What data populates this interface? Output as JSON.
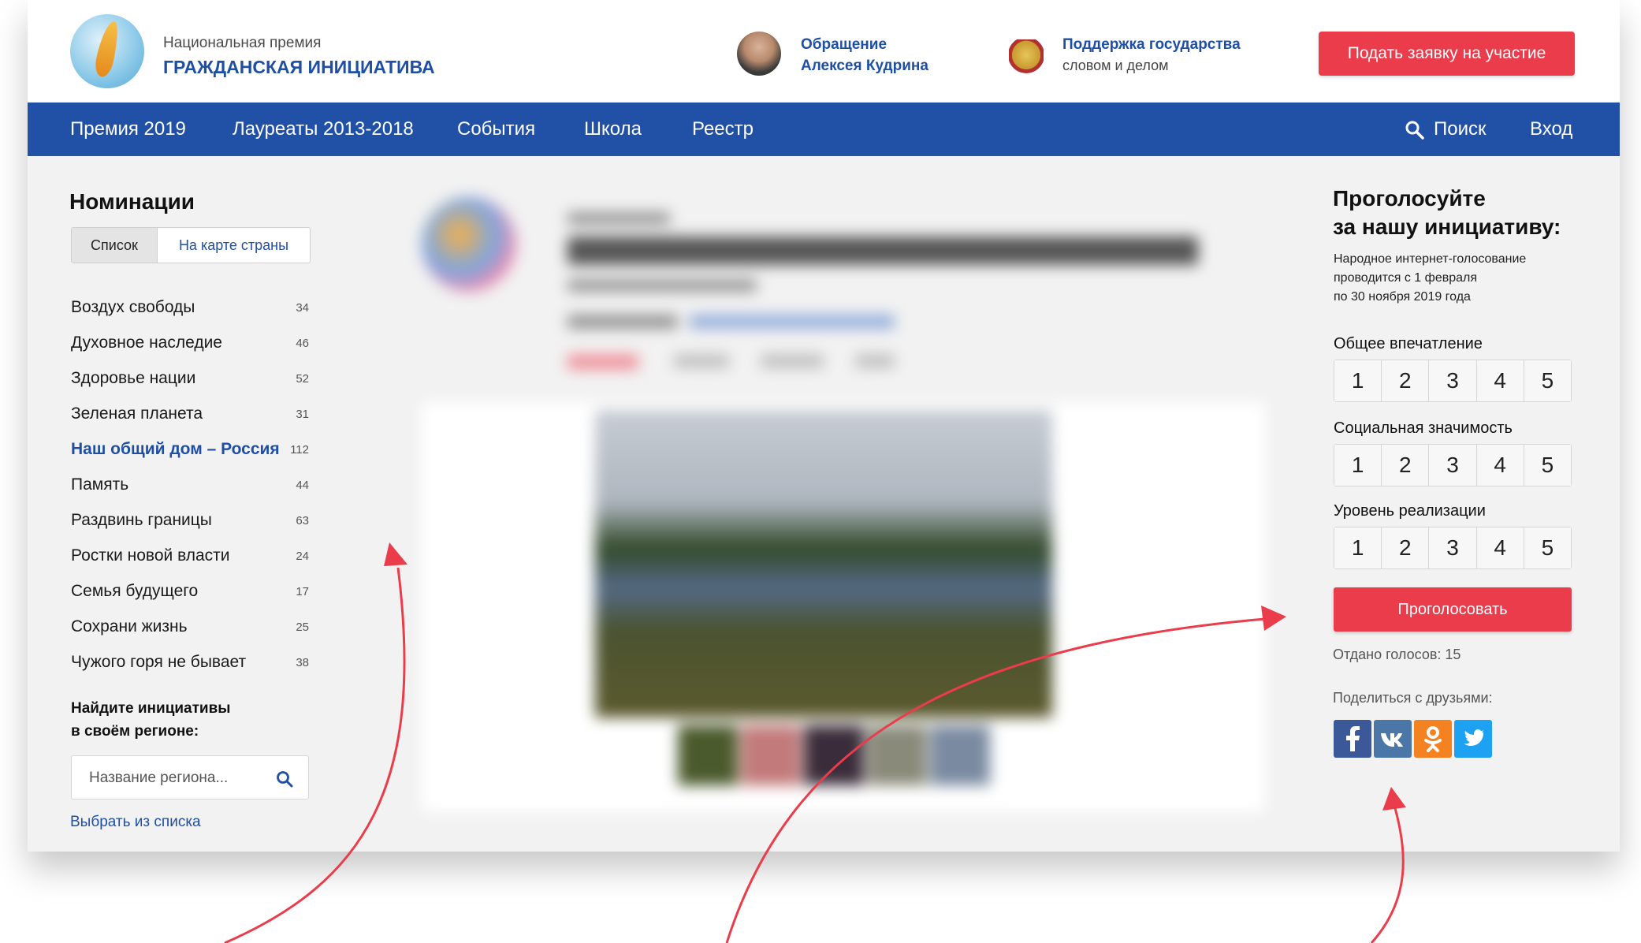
{
  "header": {
    "brand_subtitle": "Национальная премия",
    "brand_title": "ГРАЖДАНСКАЯ ИНИЦИАТИВА",
    "appeal_line1": "Обращение",
    "appeal_line2": "Алексея Кудрина",
    "support_line1": "Поддержка государства",
    "support_line2": "словом и делом",
    "apply_button": "Подать заявку на участие"
  },
  "nav": {
    "items": [
      "Премия 2019",
      "Лауреаты 2013-2018",
      "События",
      "Школа",
      "Реестр"
    ],
    "search": "Поиск",
    "login": "Вход",
    "bg_color": "#2150a7"
  },
  "sidebar": {
    "title": "Номинации",
    "toggle_list": "Список",
    "toggle_map": "На карте страны",
    "nominations": [
      {
        "name": "Воздух свободы",
        "count": "34"
      },
      {
        "name": "Духовное наследие",
        "count": "46"
      },
      {
        "name": "Здоровье нации",
        "count": "52"
      },
      {
        "name": "Зеленая планета",
        "count": "31"
      },
      {
        "name": "Наш общий дом – Россия",
        "count": "112"
      },
      {
        "name": "Память",
        "count": "44"
      },
      {
        "name": "Раздвинь границы",
        "count": "63"
      },
      {
        "name": "Ростки новой власти",
        "count": "24"
      },
      {
        "name": "Семья будущего",
        "count": "17"
      },
      {
        "name": "Сохрани жизнь",
        "count": "25"
      },
      {
        "name": "Чужого горя не бывает",
        "count": "38"
      }
    ],
    "find_line1": "Найдите инициативы",
    "find_line2": "в своём регионе:",
    "region_placeholder": "Название региона...",
    "choose_link": "Выбрать из списка"
  },
  "vote": {
    "title_line1": "Проголосуйте",
    "title_line2": "за нашу инициативу:",
    "note_line1": "Народное интернет-голосование",
    "note_line2": "проводится с 1 февраля",
    "note_line3": "по 30 ноября 2019 года",
    "criteria": [
      "Общее впечатление",
      "Социальная значимость",
      "Уровень реализации"
    ],
    "scale": [
      "1",
      "2",
      "3",
      "4",
      "5"
    ],
    "vote_button": "Проголосовать",
    "votes_count": "Отдано голосов: 15",
    "share_label": "Поделиться с друзьями:",
    "social": [
      {
        "name": "facebook-icon",
        "glyph": "f",
        "color": "#3b5998"
      },
      {
        "name": "vk-icon",
        "glyph": "VK",
        "color": "#4a76a8"
      },
      {
        "name": "odnoklassniki-icon",
        "glyph": "ok",
        "color": "#f58220"
      },
      {
        "name": "twitter-icon",
        "glyph": "tw",
        "color": "#1da1f2"
      }
    ]
  },
  "colors": {
    "accent_red": "#ea3c4b",
    "link_blue": "#1f4fa5"
  }
}
